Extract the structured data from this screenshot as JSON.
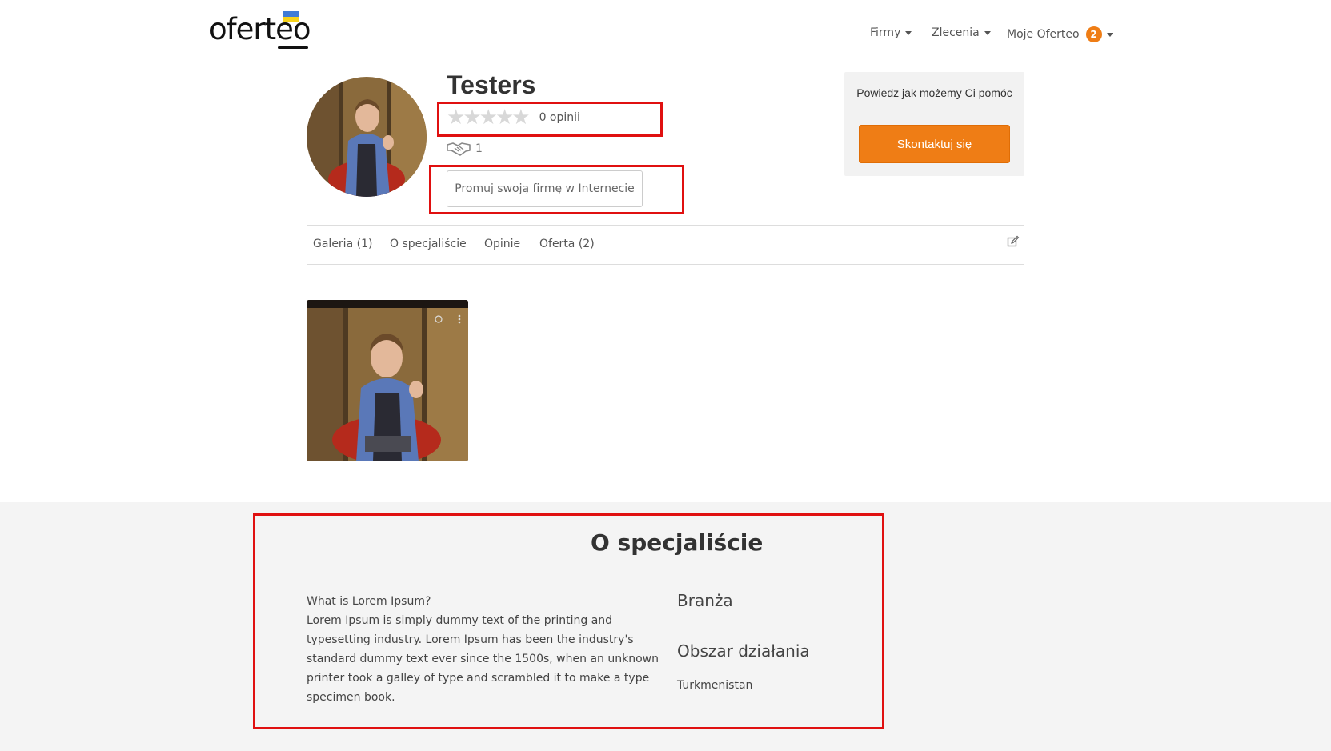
{
  "header": {
    "logo_text": "oferteo",
    "nav": {
      "firmy": "Firmy",
      "zlecenia": "Zlecenia",
      "moje_oferteo": "Moje Oferteo",
      "moje_badge": "2"
    }
  },
  "profile": {
    "name": "Testers",
    "rating_stars": 0,
    "reviews_label": "0 opinii",
    "deals_count": "1",
    "promo_button": "Promuj swoją firmę w Internecie"
  },
  "help_card": {
    "text": "Powiedz jak możemy Ci pomóc",
    "button": "Skontaktuj się"
  },
  "tabs": [
    {
      "label": "Galeria (1)"
    },
    {
      "label": "O specjaliście"
    },
    {
      "label": "Opinie"
    },
    {
      "label": "Oferta (2)"
    }
  ],
  "about": {
    "title": "O specjaliście",
    "heading": "What is Lorem Ipsum?",
    "body": "Lorem Ipsum is simply dummy text of the printing and typesetting industry. Lorem Ipsum has been the industry's standard dummy text ever since the 1500s, when an unknown printer took a galley of type and scrambled it to make a type specimen book.",
    "industry_label": "Branża",
    "area_label": "Obszar działania",
    "area_value": "Turkmenistan"
  },
  "colors": {
    "accent": "#ef7d15",
    "highlight": "#e01010",
    "section_bg": "#f4f4f4"
  },
  "icons": [
    "flag-icon",
    "caret-down-icon",
    "star-icon",
    "handshake-icon",
    "edit-icon"
  ]
}
